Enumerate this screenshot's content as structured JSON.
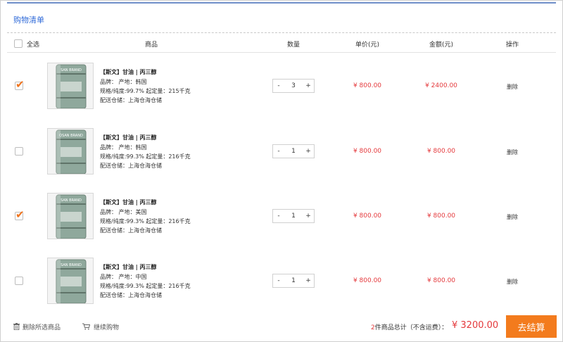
{
  "page": {
    "title": "购物清单"
  },
  "header": {
    "select_all": "全选",
    "product": "商品",
    "quantity": "数量",
    "unit_price": "单价(元)",
    "amount": "金额(元)",
    "action": "操作"
  },
  "items": [
    {
      "checked": true,
      "brand_label": "SAN BRAND",
      "name": "【斯文】甘油 | 丙三醇",
      "brand_origin": "品牌：   产地：韩国",
      "spec": "规格/纯度:99.7%  起定量：215千克",
      "warehouse": "配送仓储：上海仓海仓储",
      "qty": "3",
      "minus": "-",
      "plus": "+",
      "price": "¥ 800.00",
      "amount": "¥ 2400.00",
      "delete": "删除"
    },
    {
      "checked": false,
      "brand_label": "OSAN BRAND",
      "name": "【斯文】甘油 | 丙三醇",
      "brand_origin": "品牌：   产地：韩国",
      "spec": "规格/纯度:99.3%  起定量：216千克",
      "warehouse": "配送仓储：上海仓海仓储",
      "qty": "1",
      "minus": "-",
      "plus": "+",
      "price": "¥ 800.00",
      "amount": "¥ 800.00",
      "delete": "删除"
    },
    {
      "checked": true,
      "brand_label": "SAN BRAND",
      "name": "【斯文】甘油 | 丙三醇",
      "brand_origin": "品牌：   产地：美国",
      "spec": "规格/纯度:99.3%  起定量：216千克",
      "warehouse": "配送仓储：上海仓海仓储",
      "qty": "1",
      "minus": "-",
      "plus": "+",
      "price": "¥ 800.00",
      "amount": "¥ 800.00",
      "delete": "删除"
    },
    {
      "checked": false,
      "brand_label": "SAN BRAND",
      "name": "【斯文】甘油 | 丙三醇",
      "brand_origin": "品牌：   产地：中国",
      "spec": "规格/纯度:99.3%  起定量：216千克",
      "warehouse": "配送仓储：上海仓海仓储",
      "qty": "1",
      "minus": "-",
      "plus": "+",
      "price": "¥ 800.00",
      "amount": "¥ 800.00",
      "delete": "删除"
    }
  ],
  "footer": {
    "delete_selected": "删除所选商品",
    "continue_shopping": "继续购物",
    "count": "2",
    "summary_text": "件商品总计（不含运费）：",
    "total": "¥ 3200.00",
    "checkout": "去结算"
  },
  "colors": {
    "accent": "#f37b1d",
    "price": "#e4393c",
    "title": "#2f6ad8",
    "check": "#f0731c"
  },
  "icons": {
    "trash": "trash-icon",
    "cart": "cart-icon",
    "check": "checkmark-icon"
  }
}
